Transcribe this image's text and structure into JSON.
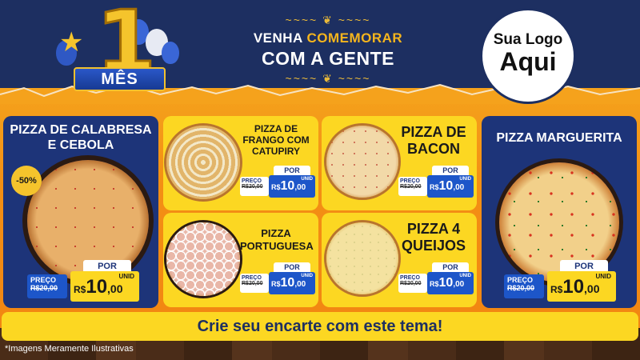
{
  "header": {
    "badge_label": "MÊS",
    "badge_number": "1",
    "headline_prefix": "VENHA ",
    "headline_accent": "COMEMORAR",
    "headline_line2": "COM A GENTE",
    "flourish": "~~~~ ❦ ~~~~",
    "logo_line1": "Sua Logo",
    "logo_line2": "Aqui"
  },
  "products": [
    {
      "title_line1": "PIZZA DE CALABRESA",
      "title_line2": "E CEBOLA",
      "badge": "-50%",
      "preco_label": "PREÇO",
      "old_price": "R$20,00",
      "por_label": "POR",
      "currency": "R$",
      "price": "10",
      "cents": ",00",
      "unit": "UNID"
    },
    {
      "title_line1": "PIZZA DE",
      "title_line2": "FRANGO COM",
      "title_line3": "CATUPIRY",
      "preco_label": "PREÇO",
      "old_price": "R$20,00",
      "por_label": "POR",
      "currency": "R$",
      "price": "10",
      "cents": ",00",
      "unit": "UNID"
    },
    {
      "title_line1": "PIZZA DE",
      "title_line2": "BACON",
      "preco_label": "PREÇO",
      "old_price": "R$20,00",
      "por_label": "POR",
      "currency": "R$",
      "price": "10",
      "cents": ",00",
      "unit": "UNID"
    },
    {
      "title_line1": "PIZZA MARGUERITA",
      "preco_label": "PREÇO",
      "old_price": "R$20,00",
      "por_label": "POR",
      "currency": "R$",
      "price": "10",
      "cents": ",00",
      "unit": "UNID"
    },
    {
      "title_line1": "PIZZA",
      "title_line2": "PORTUGUESA",
      "preco_label": "PREÇO",
      "old_price": "R$20,00",
      "por_label": "POR",
      "currency": "R$",
      "price": "10",
      "cents": ",00",
      "unit": "UNID"
    },
    {
      "title_line1": "PIZZA 4",
      "title_line2": "QUEIJOS",
      "preco_label": "PREÇO",
      "old_price": "R$20,00",
      "por_label": "POR",
      "currency": "R$",
      "price": "10",
      "cents": ",00",
      "unit": "UNID"
    }
  ],
  "footer": {
    "banner_text": "Crie seu encarte com este tema!",
    "disclaimer": "*Imagens Meramente Ilustrativas"
  },
  "colors": {
    "navy": "#1d2f61",
    "card_blue": "#1d3479",
    "price_blue": "#1d56c9",
    "yellow": "#fcd722",
    "orange": "#f38f14",
    "gold": "#f5c42c"
  }
}
